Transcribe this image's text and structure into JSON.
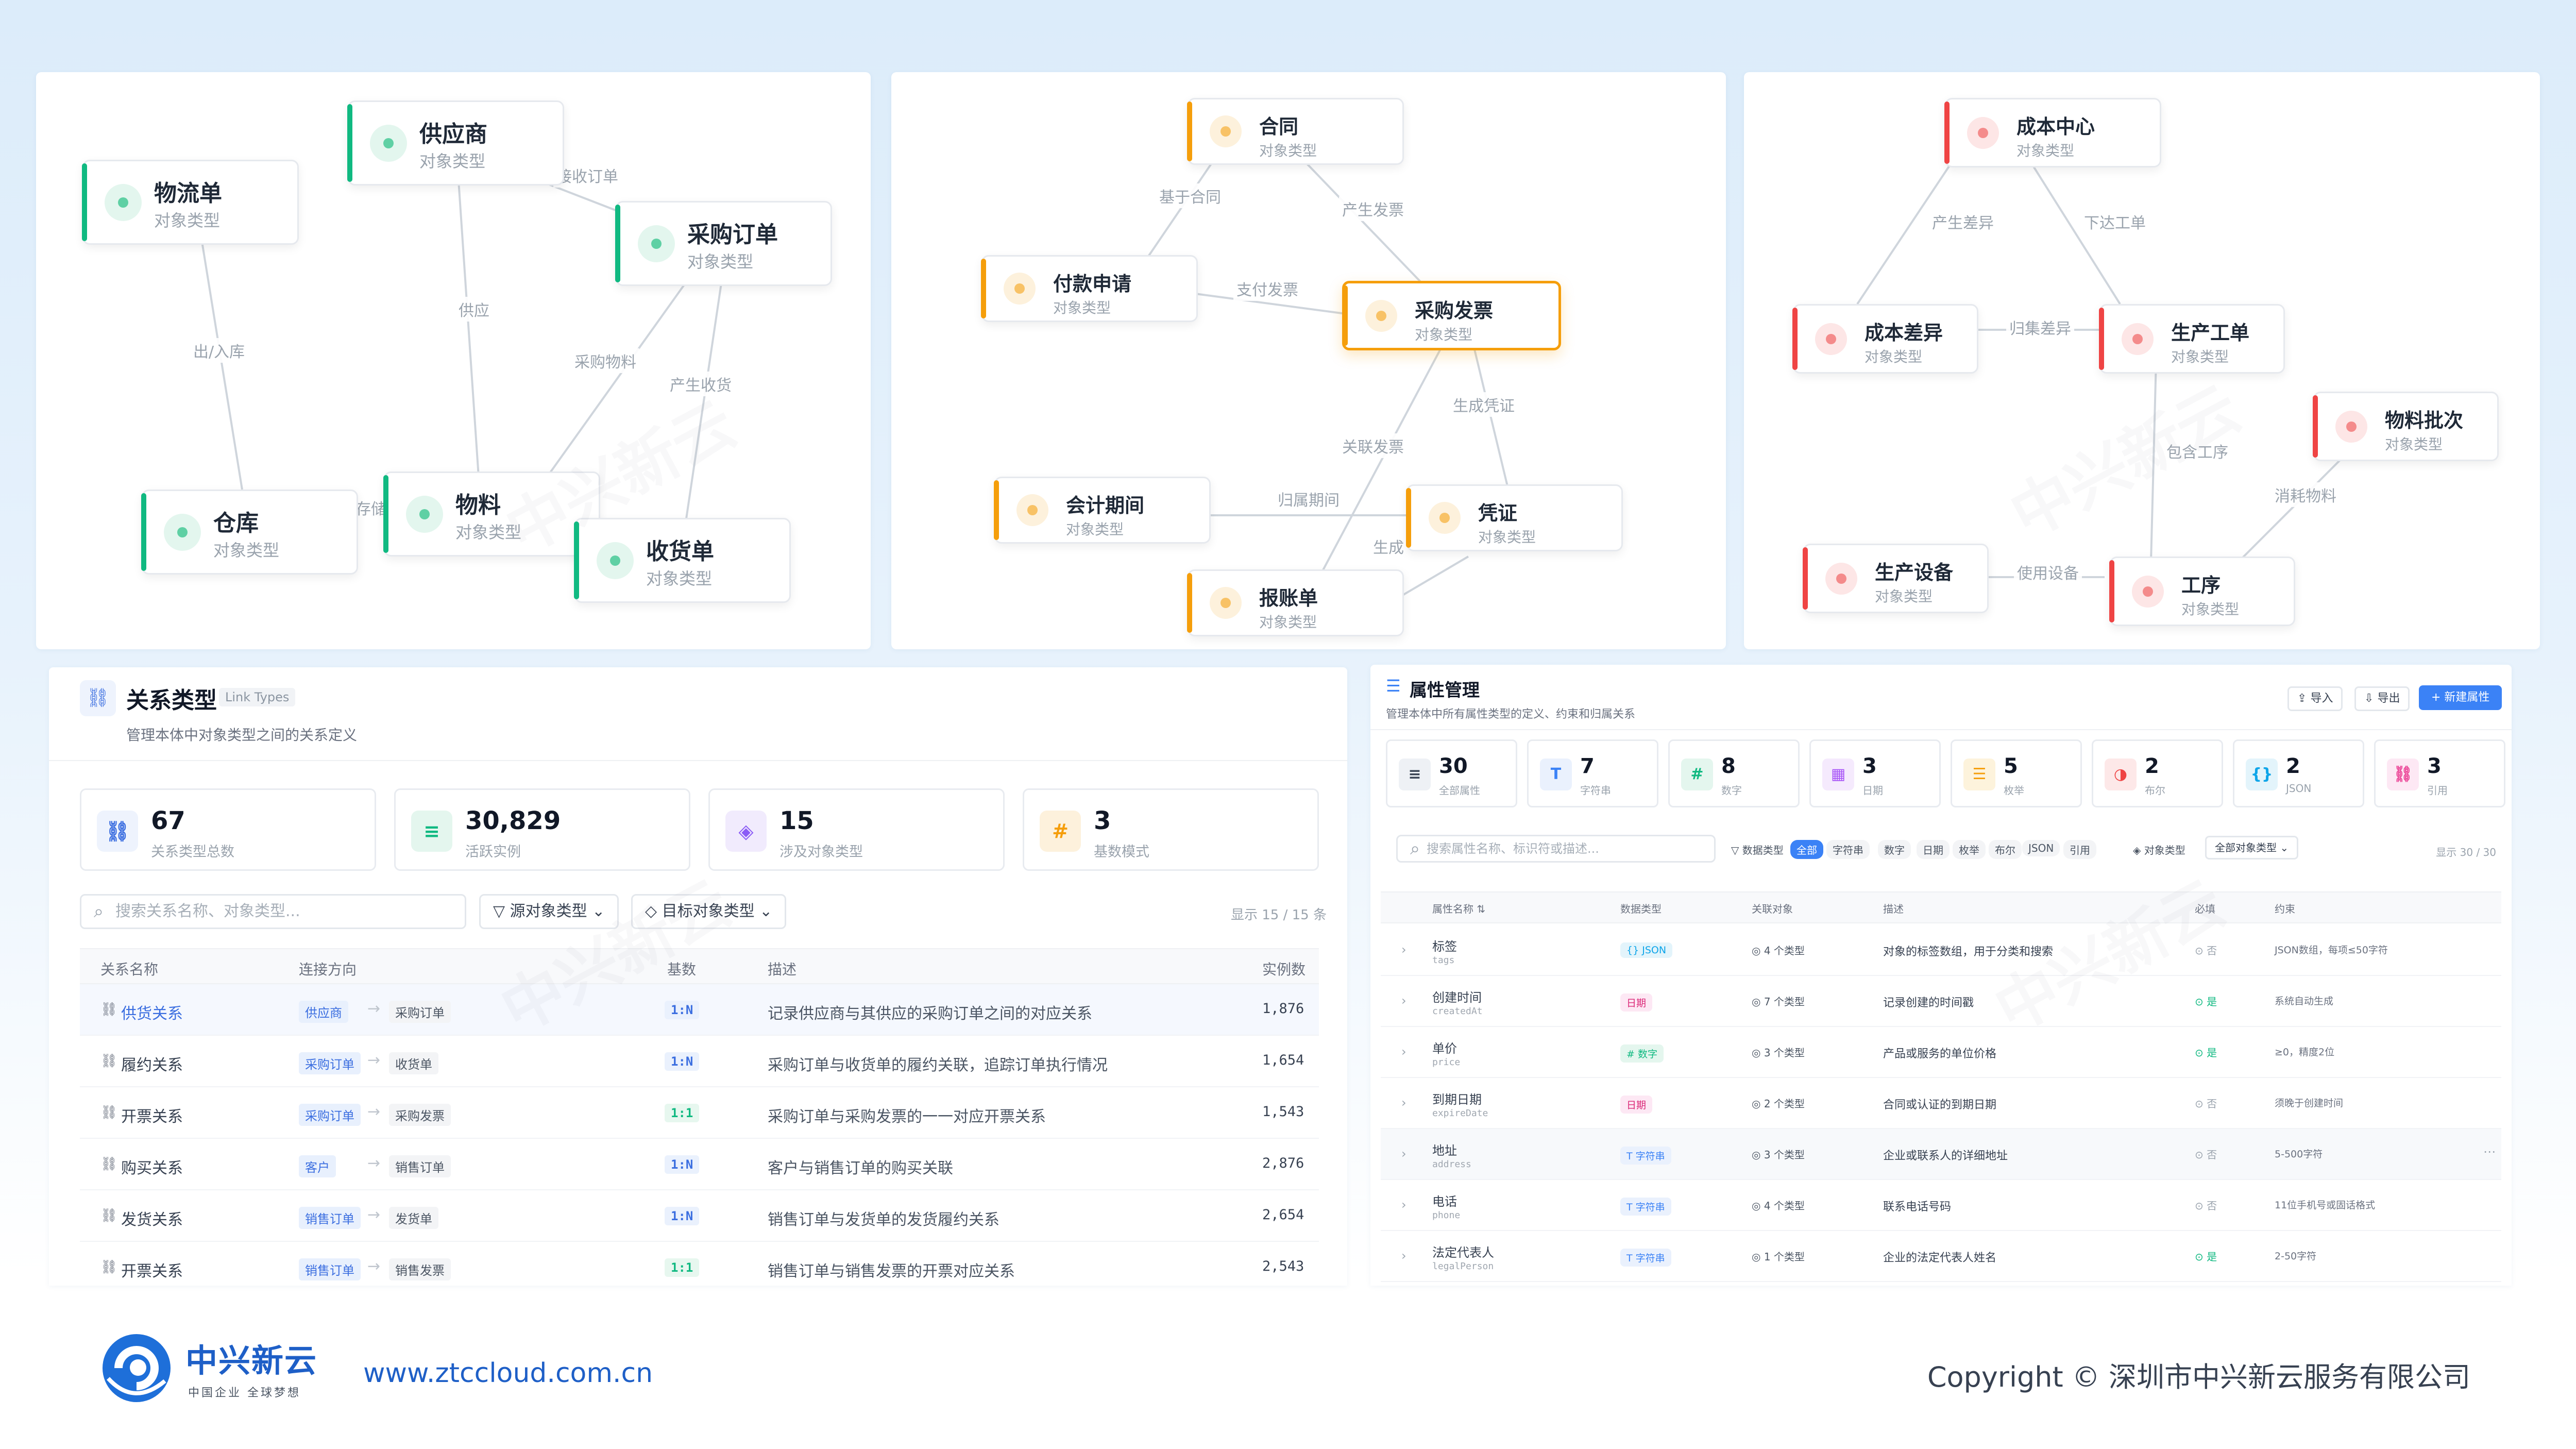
{
  "graph1": {
    "nodes": [
      {
        "id": "wuliudan",
        "label": "物流单",
        "sub": "对象类型"
      },
      {
        "id": "gongyingshang",
        "label": "供应商",
        "sub": "对象类型"
      },
      {
        "id": "caigoudingdan",
        "label": "采购订单",
        "sub": "对象类型"
      },
      {
        "id": "cangku",
        "label": "仓库",
        "sub": "对象类型"
      },
      {
        "id": "wuliao",
        "label": "物料",
        "sub": "对象类型"
      },
      {
        "id": "shouhuodan",
        "label": "收货单",
        "sub": "对象类型"
      }
    ],
    "edges": [
      {
        "label": "出/入库"
      },
      {
        "label": "接收订单"
      },
      {
        "label": "供应"
      },
      {
        "label": "采购物料"
      },
      {
        "label": "产生收货"
      },
      {
        "label": "存储"
      }
    ]
  },
  "graph2": {
    "nodes": [
      {
        "id": "hetong",
        "label": "合同",
        "sub": "对象类型"
      },
      {
        "id": "fukuan",
        "label": "付款申请",
        "sub": "对象类型"
      },
      {
        "id": "caigoufapiao",
        "label": "采购发票",
        "sub": "对象类型"
      },
      {
        "id": "kuaiji",
        "label": "会计期间",
        "sub": "对象类型"
      },
      {
        "id": "pingzheng",
        "label": "凭证",
        "sub": "对象类型"
      },
      {
        "id": "baozhang",
        "label": "报账单",
        "sub": "对象类型"
      }
    ],
    "edges": [
      {
        "label": "基于合同"
      },
      {
        "label": "产生发票"
      },
      {
        "label": "支付发票"
      },
      {
        "label": "生成凭证"
      },
      {
        "label": "关联发票"
      },
      {
        "label": "归属期间"
      },
      {
        "label": "生成"
      }
    ]
  },
  "graph3": {
    "nodes": [
      {
        "id": "chengben",
        "label": "成本中心",
        "sub": "对象类型"
      },
      {
        "id": "chayi",
        "label": "成本差异",
        "sub": "对象类型"
      },
      {
        "id": "gongdan",
        "label": "生产工单",
        "sub": "对象类型"
      },
      {
        "id": "pici",
        "label": "物料批次",
        "sub": "对象类型"
      },
      {
        "id": "shebei",
        "label": "生产设备",
        "sub": "对象类型"
      },
      {
        "id": "gongxu",
        "label": "工序",
        "sub": "对象类型"
      }
    ],
    "edges": [
      {
        "label": "产生差异"
      },
      {
        "label": "下达工单"
      },
      {
        "label": "归集差异"
      },
      {
        "label": "包含工序"
      },
      {
        "label": "消耗物料"
      },
      {
        "label": "使用设备"
      }
    ]
  },
  "watermark": "中兴新云",
  "linkTypes": {
    "title": "关系类型",
    "badge": "Link Types",
    "subtitle": "管理本体中对象类型之间的关系定义",
    "stats": [
      {
        "value": "67",
        "label": "关系类型总数"
      },
      {
        "value": "30,829",
        "label": "活跃实例"
      },
      {
        "value": "15",
        "label": "涉及对象类型"
      },
      {
        "value": "3",
        "label": "基数模式"
      }
    ],
    "searchPlaceholder": "搜索关系名称、对象类型...",
    "filterSource": "源对象类型",
    "filterTarget": "目标对象类型",
    "showing": "显示 15 / 15 条",
    "columns": [
      "关系名称",
      "连接方向",
      "基数",
      "描述",
      "实例数"
    ],
    "rows": [
      {
        "name": "供货关系",
        "from": "供应商",
        "to": "采购订单",
        "card": "1:N",
        "desc": "记录供应商与其供应的采购订单之间的对应关系",
        "count": "1,876"
      },
      {
        "name": "履约关系",
        "from": "采购订单",
        "to": "收货单",
        "card": "1:N",
        "desc": "采购订单与收货单的履约关联，追踪订单执行情况",
        "count": "1,654"
      },
      {
        "name": "开票关系",
        "from": "采购订单",
        "to": "采购发票",
        "card": "1:1",
        "desc": "采购订单与采购发票的一一对应开票关系",
        "count": "1,543"
      },
      {
        "name": "购买关系",
        "from": "客户",
        "to": "销售订单",
        "card": "1:N",
        "desc": "客户与销售订单的购买关联",
        "count": "2,876"
      },
      {
        "name": "发货关系",
        "from": "销售订单",
        "to": "发货单",
        "card": "1:N",
        "desc": "销售订单与发货单的发货履约关系",
        "count": "2,654"
      },
      {
        "name": "开票关系",
        "from": "销售订单",
        "to": "销售发票",
        "card": "1:1",
        "desc": "销售订单与销售发票的开票对应关系",
        "count": "2,543"
      }
    ]
  },
  "props": {
    "title": "属性管理",
    "subtitle": "管理本体中所有属性类型的定义、约束和归属关系",
    "btnImport": "导入",
    "btnExport": "导出",
    "btnNew": "+ 新建属性",
    "stats": [
      {
        "icon": "database-icon",
        "value": "30",
        "label": "全部属性"
      },
      {
        "icon": "text-icon",
        "value": "7",
        "label": "字符串"
      },
      {
        "icon": "hash-icon",
        "value": "8",
        "label": "数字"
      },
      {
        "icon": "calendar-icon",
        "value": "3",
        "label": "日期"
      },
      {
        "icon": "list-icon",
        "value": "5",
        "label": "枚举"
      },
      {
        "icon": "toggle-icon",
        "value": "2",
        "label": "布尔"
      },
      {
        "icon": "json-icon",
        "value": "2",
        "label": "JSON"
      },
      {
        "icon": "link-icon",
        "value": "3",
        "label": "引用"
      }
    ],
    "searchPlaceholder": "搜索属性名称、标识符或描述...",
    "typeLabel": "数据类型",
    "typeChips": [
      "全部",
      "字符串",
      "数字",
      "日期",
      "枚举",
      "布尔",
      "JSON",
      "引用"
    ],
    "objLabel": "对象类型",
    "objSelect": "全部对象类型",
    "showing": "显示 30 / 30",
    "columns": [
      "属性名称 ⇅",
      "数据类型",
      "关联对象",
      "描述",
      "必填",
      "约束"
    ],
    "rows": [
      {
        "name": "标签",
        "code": "tags",
        "type": "{} JSON",
        "rel": "4 个类型",
        "desc": "对象的标签数组，用于分类和搜索",
        "req": "否",
        "cons": "JSON数组，每项≤50字符"
      },
      {
        "name": "创建时间",
        "code": "createdAt",
        "type": "日期",
        "rel": "7 个类型",
        "desc": "记录创建的时间戳",
        "req": "是",
        "cons": "系统自动生成"
      },
      {
        "name": "单价",
        "code": "price",
        "type": "# 数字",
        "rel": "3 个类型",
        "desc": "产品或服务的单位价格",
        "req": "是",
        "cons": "≥0，精度2位"
      },
      {
        "name": "到期日期",
        "code": "expireDate",
        "type": "日期",
        "rel": "2 个类型",
        "desc": "合同或认证的到期日期",
        "req": "否",
        "cons": "须晚于创建时间"
      },
      {
        "name": "地址",
        "code": "address",
        "type": "T 字符串",
        "rel": "3 个类型",
        "desc": "企业或联系人的详细地址",
        "req": "否",
        "cons": "5-500字符"
      },
      {
        "name": "电话",
        "code": "phone",
        "type": "T 字符串",
        "rel": "4 个类型",
        "desc": "联系电话号码",
        "req": "否",
        "cons": "11位手机号或固话格式"
      },
      {
        "name": "法定代表人",
        "code": "legalPerson",
        "type": "T 字符串",
        "rel": "1 个类型",
        "desc": "企业的法定代表人姓名",
        "req": "是",
        "cons": "2-50字符"
      }
    ]
  },
  "footer": {
    "logoText": "中兴新云",
    "logoSlogan": "中国企业 全球梦想",
    "url": "www.ztccloud.com.cn",
    "copyright": "Copyright © 深圳市中兴新云服务有限公司"
  },
  "colors": {
    "green": "#10b981",
    "orange": "#f59e0b",
    "red": "#ef4444",
    "primary": "#3b82f6"
  }
}
